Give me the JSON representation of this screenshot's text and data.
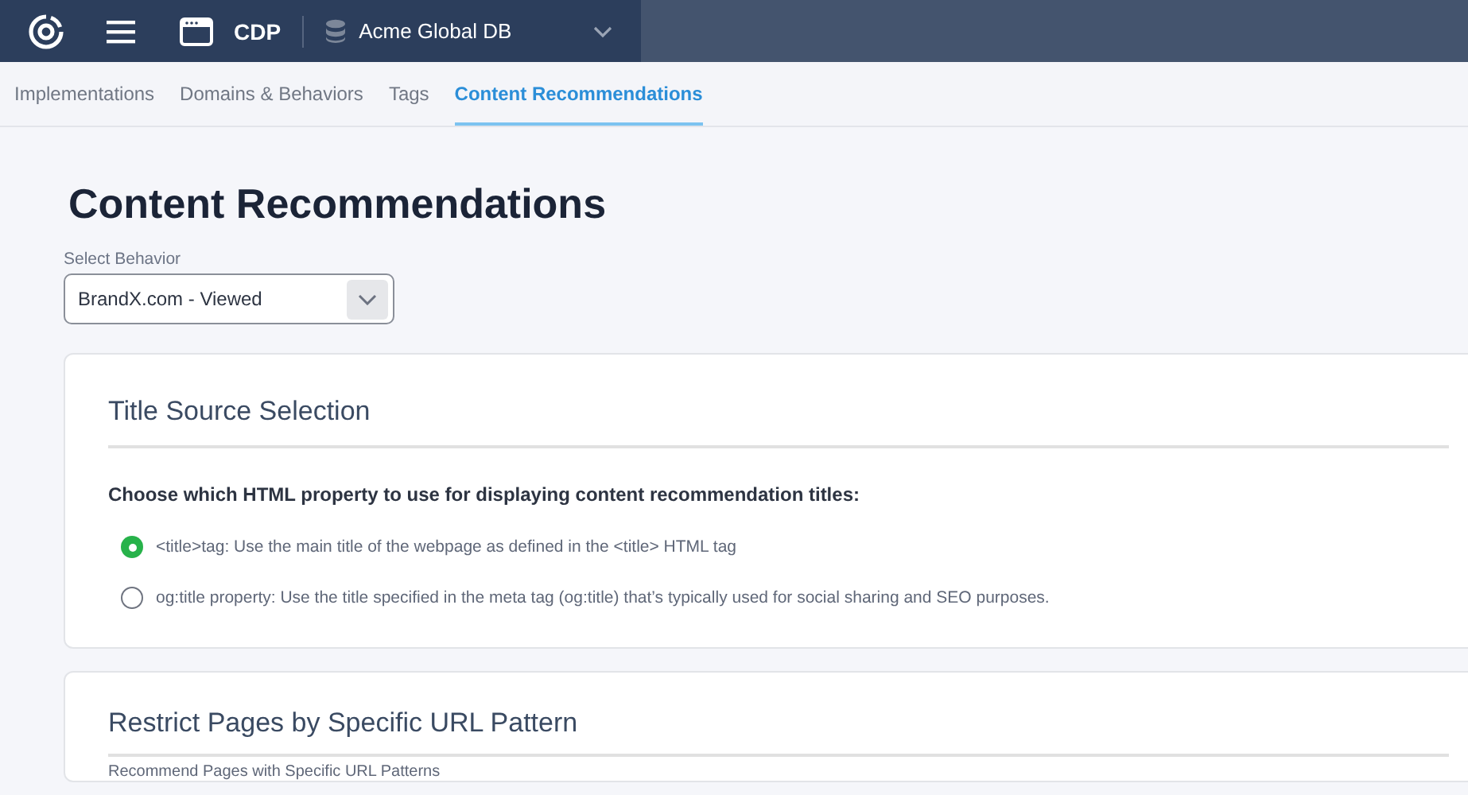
{
  "topbar": {
    "app_name": "CDP",
    "database": "Acme Global DB"
  },
  "tabs": [
    {
      "label": "Implementations",
      "selected": false
    },
    {
      "label": "Domains & Behaviors",
      "selected": false
    },
    {
      "label": "Tags",
      "selected": false
    },
    {
      "label": "Content Recommendations",
      "selected": true
    }
  ],
  "page_title": "Content Recommendations",
  "behavior_select": {
    "label": "Select Behavior",
    "value": "BrandX.com - Viewed"
  },
  "title_source": {
    "heading": "Title Source Selection",
    "question": "Choose which HTML property to use for displaying content recommendation titles:",
    "options": [
      {
        "label": "<title>tag: Use the main title of the webpage as defined in the <title> HTML tag",
        "selected": true
      },
      {
        "label": "og:title property: Use the title specified in the meta tag (og:title) that’s typically used for social sharing and SEO purposes.",
        "selected": false
      }
    ]
  },
  "url_pattern": {
    "heading": "Restrict Pages by Specific URL Pattern",
    "subheading": "Recommend Pages with Specific URL Patterns"
  }
}
